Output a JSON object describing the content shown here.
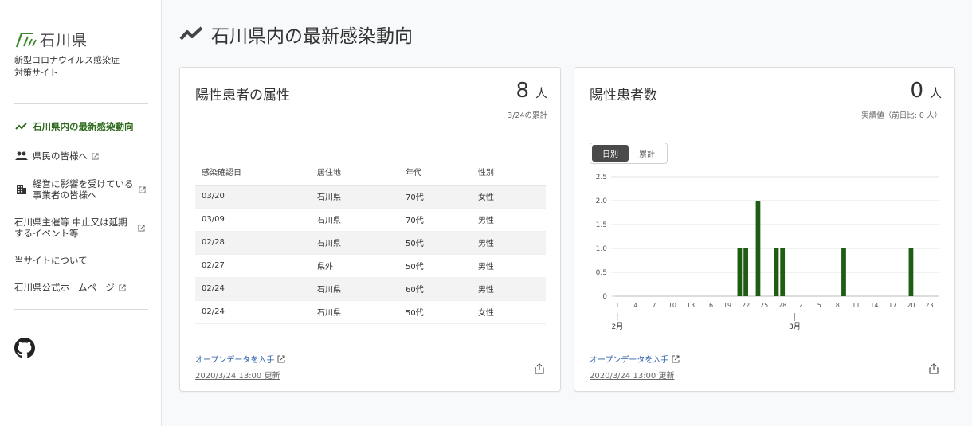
{
  "sidebar": {
    "logo_text": "石川県",
    "site_desc": "新型コロナウイルス感染症対策サイト",
    "nav": [
      {
        "label": "石川県内の最新感染動向",
        "icon": "trend-icon"
      },
      {
        "label": "県民の皆様へ",
        "icon": "people-icon"
      },
      {
        "label": "経営に影響を受けている事業者の皆様へ",
        "icon": "building-icon"
      },
      {
        "label": "石川県主催等 中止又は延期するイベント等"
      },
      {
        "label": "当サイトについて"
      },
      {
        "label": "石川県公式ホームページ"
      }
    ]
  },
  "page_title": "石川県内の最新感染動向",
  "patients_card": {
    "title": "陽性患者の属性",
    "count": "8",
    "unit": "人",
    "note": "3/24の累計",
    "headers": [
      "感染確認日",
      "居住地",
      "年代",
      "性別"
    ],
    "rows": [
      [
        "03/20",
        "石川県",
        "70代",
        "女性"
      ],
      [
        "03/09",
        "石川県",
        "70代",
        "男性"
      ],
      [
        "02/28",
        "石川県",
        "50代",
        "男性"
      ],
      [
        "02/27",
        "県外",
        "50代",
        "男性"
      ],
      [
        "02/24",
        "石川県",
        "60代",
        "男性"
      ],
      [
        "02/24",
        "石川県",
        "50代",
        "女性"
      ]
    ],
    "open_data": "オープンデータを入手",
    "updated": "2020/3/24 13:00 更新"
  },
  "count_card": {
    "title": "陽性患者数",
    "count": "0",
    "unit": "人",
    "note": "実績値（前日比: 0 人）",
    "toggle": [
      "日別",
      "累計"
    ],
    "open_data": "オープンデータを入手",
    "updated": "2020/3/24 13:00 更新"
  },
  "colors": {
    "accent": "#2e6b1e",
    "bar": "#1f5c14",
    "link": "#2a5ea8"
  },
  "chart_data": {
    "type": "bar",
    "ylim": [
      0,
      2.5
    ],
    "yticks": [
      "0",
      "0.5",
      "1.0",
      "1.5",
      "2.0",
      "2.5"
    ],
    "x_tick_labels": [
      "1",
      "4",
      "7",
      "10",
      "13",
      "16",
      "19",
      "22",
      "25",
      "28",
      "2",
      "5",
      "8",
      "11",
      "14",
      "17",
      "20",
      "23"
    ],
    "month_labels": [
      "2月",
      "3月"
    ],
    "bars": [
      {
        "date": "2020-02-21",
        "value": 1
      },
      {
        "date": "2020-02-22",
        "value": 1
      },
      {
        "date": "2020-02-24",
        "value": 2
      },
      {
        "date": "2020-02-27",
        "value": 1
      },
      {
        "date": "2020-02-28",
        "value": 1
      },
      {
        "date": "2020-03-09",
        "value": 1
      },
      {
        "date": "2020-03-20",
        "value": 1
      }
    ]
  }
}
